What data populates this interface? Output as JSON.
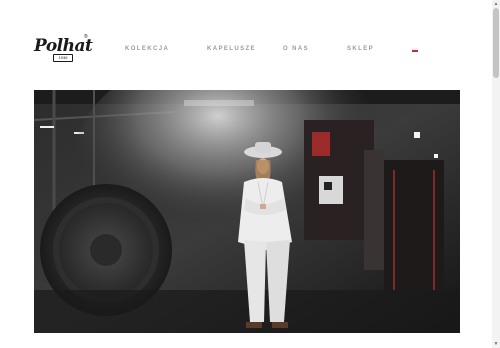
{
  "brand": {
    "logo_text": "Polhat",
    "logo_registered": "®",
    "logo_year": "1936"
  },
  "nav": {
    "items": [
      {
        "label": "KOLEKCJA"
      },
      {
        "label": "KAPELUSZE"
      },
      {
        "label": "O NAS"
      },
      {
        "label": "SKLEP"
      }
    ],
    "language": {
      "icon": "poland-flag-icon",
      "colors": [
        "#f2f2f2",
        "#d4213d"
      ]
    }
  },
  "hero": {
    "image": "woman-in-white-suit-and-hat-in-factory"
  },
  "scrollbar": {
    "up_icon": "▲",
    "down_icon": "▼"
  }
}
